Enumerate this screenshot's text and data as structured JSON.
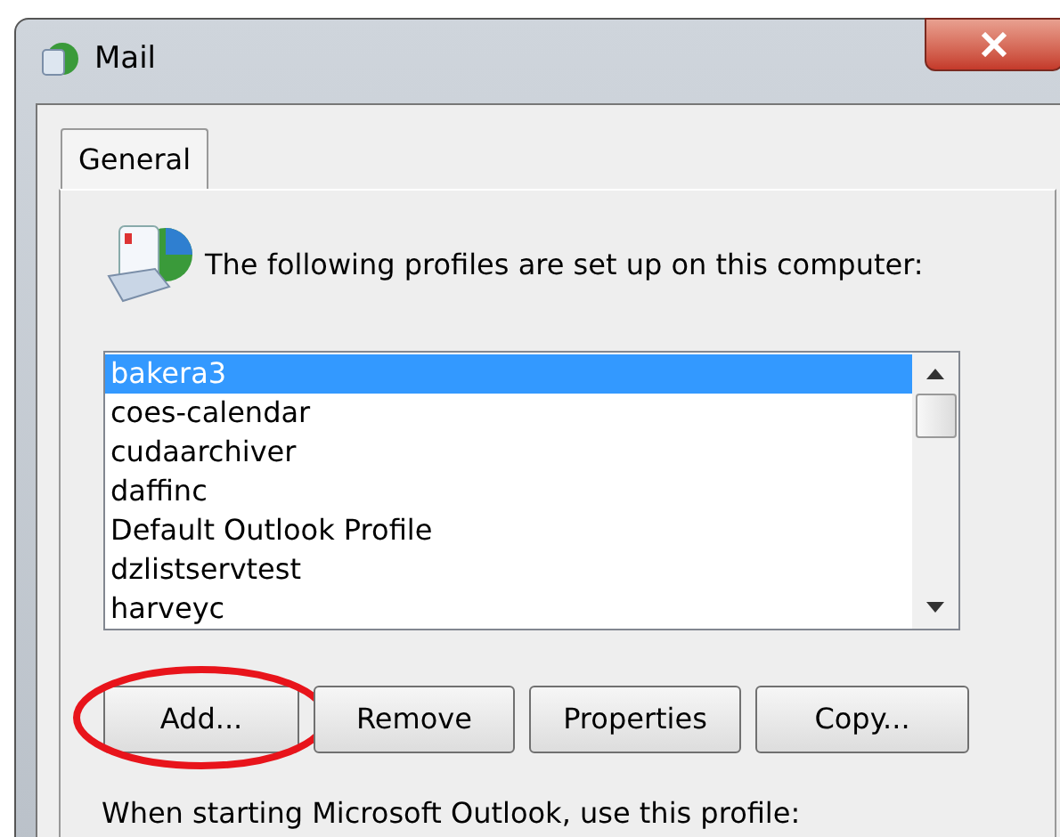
{
  "window": {
    "title": "Mail"
  },
  "tabs": [
    {
      "label": "General",
      "selected": true
    }
  ],
  "prompt": "The following profiles are set up on this computer:",
  "profiles": [
    {
      "name": "bakera3",
      "selected": true
    },
    {
      "name": "coes-calendar",
      "selected": false
    },
    {
      "name": "cudaarchiver",
      "selected": false
    },
    {
      "name": "daffinc",
      "selected": false
    },
    {
      "name": "Default Outlook Profile",
      "selected": false
    },
    {
      "name": "dzlistservtest",
      "selected": false
    },
    {
      "name": "harveyc",
      "selected": false
    }
  ],
  "buttons": [
    {
      "label": "Add...",
      "circled": true
    },
    {
      "label": "Remove",
      "circled": false
    },
    {
      "label": "Properties",
      "circled": false
    },
    {
      "label": "Copy...",
      "circled": false
    }
  ],
  "startup_label": "When starting Microsoft Outlook, use this profile:"
}
